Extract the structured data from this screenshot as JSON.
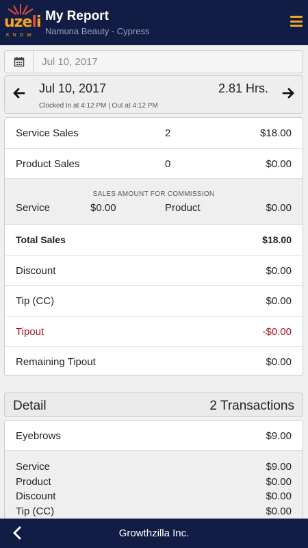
{
  "header": {
    "logo_text": "uzeli",
    "logo_sub": "KNOW",
    "title": "My Report",
    "subtitle": "Namuna Beauty - Cypress",
    "menu_icon": "hamburger-menu-icon"
  },
  "date_input": {
    "value": "Jul 10, 2017",
    "icon": "calendar-icon"
  },
  "day_nav": {
    "date": "Jul 10, 2017",
    "hours": "2.81 Hrs.",
    "clock_info": "Clocked In at 4:12 PM | Out at 4:12 PM"
  },
  "summary": {
    "service_sales": {
      "label": "Service Sales",
      "count": "2",
      "amount": "$18.00"
    },
    "product_sales": {
      "label": "Product Sales",
      "count": "0",
      "amount": "$0.00"
    },
    "commission": {
      "caption": "SALES AMOUNT FOR COMMISSION",
      "service_label": "Service",
      "service_value": "$0.00",
      "product_label": "Product",
      "product_value": "$0.00"
    },
    "total_sales": {
      "label": "Total Sales",
      "amount": "$18.00"
    },
    "discount": {
      "label": "Discount",
      "amount": "$0.00"
    },
    "tip": {
      "label": "Tip (CC)",
      "amount": "$0.00"
    },
    "tipout": {
      "label": "Tipout",
      "amount": "-$0.00"
    },
    "remaining_tipout": {
      "label": "Remaining Tipout",
      "amount": "$0.00"
    }
  },
  "detail": {
    "title": "Detail",
    "transactions": "2 Transactions",
    "item": {
      "name": "Eyebrows",
      "amount": "$9.00",
      "lines": [
        {
          "label": "Service",
          "value": "$9.00"
        },
        {
          "label": "Product",
          "value": "$0.00"
        },
        {
          "label": "Discount",
          "value": "$0.00"
        },
        {
          "label": "Tip (CC)",
          "value": "$0.00"
        }
      ]
    }
  },
  "footer": {
    "brand": "Growthzilla Inc.",
    "back_icon": "back-arrow-icon"
  },
  "colors": {
    "navy": "#121d45",
    "accent": "#f5a524",
    "tipout_red": "#a0141e"
  }
}
